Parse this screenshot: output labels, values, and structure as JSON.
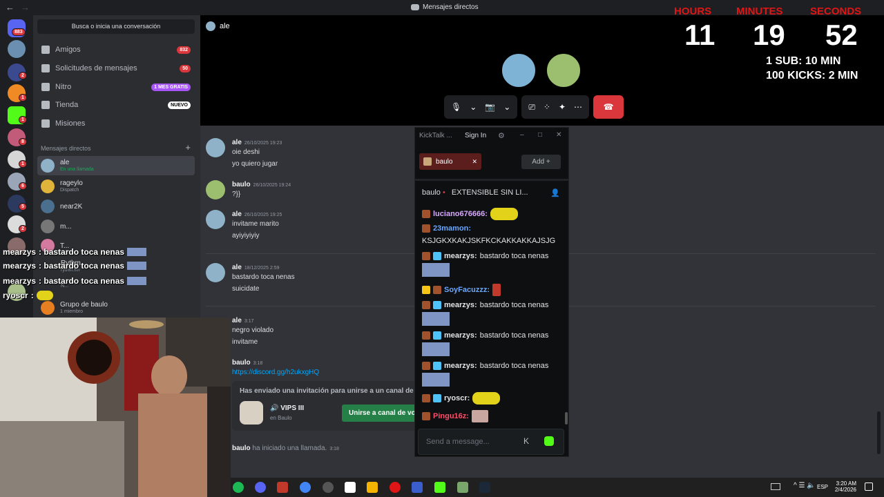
{
  "titlebar": {
    "title": "Mensajes directos"
  },
  "rail": {
    "home_badge": "883",
    "badges": [
      "2",
      "1",
      "1",
      "8",
      "1",
      "6",
      "5",
      "2",
      "1",
      "1"
    ]
  },
  "sidebar": {
    "search_label": "Busca o inicia una conversación",
    "nav": [
      {
        "label": "Amigos",
        "badge": "832",
        "badge_color": "#da373c"
      },
      {
        "label": "Solicitudes de mensajes",
        "badge": "50",
        "badge_color": "#da373c"
      },
      {
        "label": "Nitro",
        "badge": "1 MES GRATIS",
        "badge_color": "#a855f7"
      },
      {
        "label": "Tienda",
        "badge": "NUEVO",
        "badge_color": "#ffffff"
      },
      {
        "label": "Misiones",
        "badge": ""
      }
    ],
    "dm_header": "Mensajes directos",
    "dms": [
      {
        "name": "ale",
        "status": "En una llamada"
      },
      {
        "name": "rageylo",
        "status": "Dispatch"
      },
      {
        "name": "near2K",
        "status": ""
      },
      {
        "name": "m...",
        "status": ""
      },
      {
        "name": "T...",
        "status": ""
      },
      {
        "name": "Rythm",
        "status": "rythm.fm"
      },
      {
        "name": "N...",
        "status": ""
      },
      {
        "name": "Grupo de baulo",
        "status": "1 miembro"
      }
    ]
  },
  "overlay_chat": [
    {
      "user": "mearzys",
      "text": ": bastardo toca nenas"
    },
    {
      "user": "mearzys",
      "text": ": bastardo toca nenas"
    },
    {
      "user": "mearzys",
      "text": ": bastardo toca nenas"
    },
    {
      "user": "mearzys",
      "text": ": bastardo toca nenas"
    },
    {
      "user": "ryoscr",
      "text": " :"
    }
  ],
  "call": {
    "channel_name": "ale",
    "search_placeholder": "Buscar a..."
  },
  "timer": {
    "hours_label": "HOURS",
    "minutes_label": "MINUTES",
    "seconds_label": "SECONDS",
    "hours": "11",
    "minutes": "19",
    "seconds": "52",
    "rule1": "1 SUB: 10 MIN",
    "rule2": "100 KICKS: 2 MIN"
  },
  "messages": [
    {
      "author": "ale",
      "time": "26/10/2025 19:23",
      "lines": [
        "oie deshi",
        "yo quiero jugar"
      ]
    },
    {
      "author": "baulo",
      "time": "26/10/2025 19:24",
      "lines": [
        "?}}"
      ]
    },
    {
      "author": "ale",
      "time": "26/10/2025 19:25",
      "lines": [
        "invitame marito",
        "ayiyiyiyiy"
      ]
    },
    {
      "author": "ale",
      "time": "18/12/2025 2:59",
      "lines": [
        "bastardo toca nenas",
        "suicidate"
      ]
    },
    {
      "author": "ale",
      "time": "3:17",
      "lines": [
        "negro violado",
        "invitame"
      ]
    },
    {
      "author": "baulo",
      "time": "3:18",
      "lines": [
        "https://discord.gg/h2ukxgHQ"
      ]
    }
  ],
  "invite": {
    "header": "Has enviado una invitación para unirse a un canal de v",
    "channel": "VIPS III",
    "server": "en Baulo",
    "join_button": "Unirse a canal de voz"
  },
  "system_msg": {
    "author": "baulo",
    "text": "ha iniciado una llamada.",
    "time": "3:18"
  },
  "kicktalk": {
    "app_name": "KickTalk ...",
    "sign_in": "Sign In",
    "tab_label": "baulo",
    "add_button": "Add",
    "channel": "baulo",
    "stream_title": "EXTENSIBLE SIN LI...",
    "chat": [
      {
        "user": "luciano676666:",
        "text": "",
        "color": "#d8a8ff"
      },
      {
        "user": "23mamon:",
        "text": "KSJGKXKAKJSKFKCKAKKAKKAJSJG",
        "color": "#6aa7ff"
      },
      {
        "user": "mearzys:",
        "text": "bastardo toca nenas",
        "color": "#ffffff"
      },
      {
        "user": "SoyFacuzzz:",
        "text": "",
        "color": "#6aa7ff"
      },
      {
        "user": "mearzys:",
        "text": "bastardo toca nenas",
        "color": "#ffffff"
      },
      {
        "user": "mearzys:",
        "text": "bastardo toca nenas",
        "color": "#ffffff"
      },
      {
        "user": "mearzys:",
        "text": "bastardo toca nenas",
        "color": "#ffffff"
      },
      {
        "user": "ryoscr:",
        "text": "",
        "color": "#ffffff"
      },
      {
        "user": "Pingu16z:",
        "text": "",
        "color": "#ff4d6a"
      }
    ],
    "input_placeholder": "Send a message..."
  },
  "taskbar": {
    "lang": "ESP",
    "time": "3:20 AM",
    "date": "2/4/2026"
  }
}
